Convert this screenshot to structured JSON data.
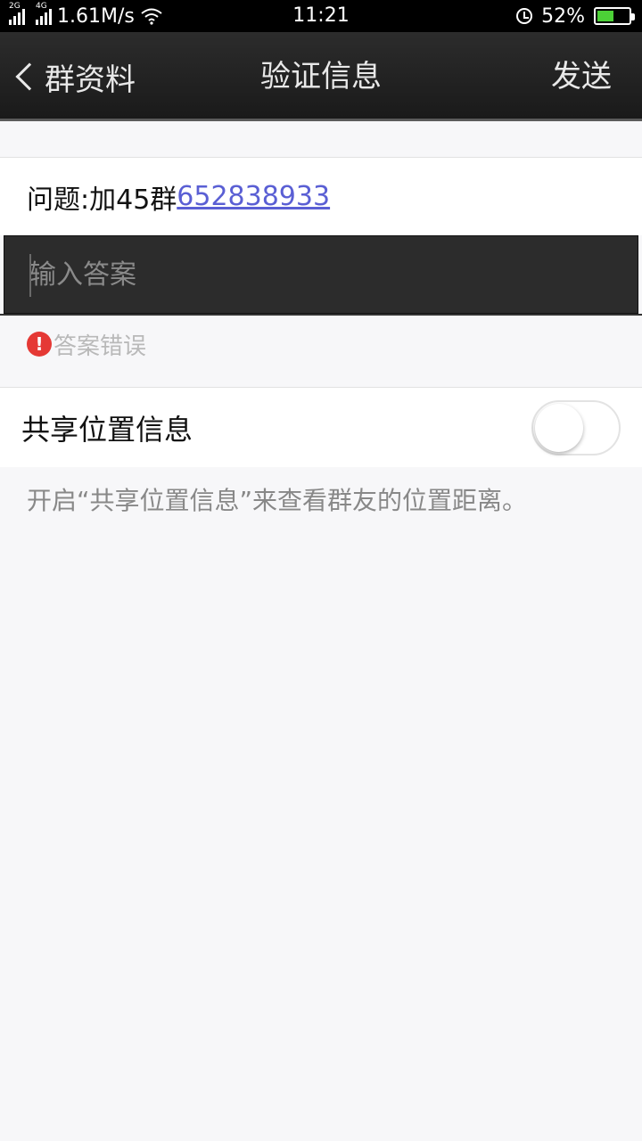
{
  "status_bar": {
    "network1": "2G",
    "network2": "4G",
    "speed": "1.61M/s",
    "time": "11:21",
    "battery_percent": "52%",
    "battery_level": 0.52,
    "icons": [
      "signal-icon",
      "wifi-icon",
      "alarm-icon",
      "battery-icon"
    ]
  },
  "nav": {
    "back_label": "群资料",
    "title": "验证信息",
    "send_label": "发送"
  },
  "question": {
    "prefix": "问题:加45群",
    "link_number": "652838933"
  },
  "answer": {
    "placeholder": "输入答案",
    "value": ""
  },
  "error": {
    "message": "答案错误"
  },
  "share_location": {
    "label": "共享位置信息",
    "enabled": false,
    "hint": "开启“共享位置信息”来查看群友的位置距离。"
  },
  "colors": {
    "link": "#5a5fd4",
    "error_icon": "#e53935",
    "nav_background": "#1f1f1f"
  }
}
